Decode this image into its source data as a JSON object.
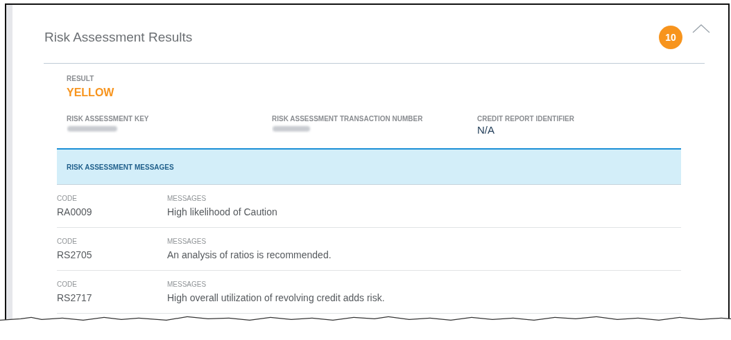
{
  "panel": {
    "title": "Risk Assessment Results",
    "badge": "10",
    "expanded": true
  },
  "result": {
    "label": "RESULT",
    "value": "YELLOW"
  },
  "fields": [
    {
      "label": "RISK ASSESSMENT KEY",
      "redacted": true
    },
    {
      "label": "RISK ASSESSMENT TRANSACTION NUMBER",
      "redacted": true
    },
    {
      "label": "CREDIT REPORT IDENTIFIER",
      "redacted": false,
      "value": "N/A"
    }
  ],
  "messages": {
    "heading": "RISK ASSESSMENT MESSAGES",
    "rows": [
      {
        "code_label": "CODE",
        "code": "RA0009",
        "message_label": "MESSAGES",
        "message": "High likelihood of Caution"
      },
      {
        "code_label": "CODE",
        "code": "RS2705",
        "message_label": "MESSAGES",
        "message": "An analysis of ratios is recommended."
      },
      {
        "code_label": "CODE",
        "code": "RS2717",
        "message_label": "MESSAGES",
        "message": "High overall utilization of revolving credit adds risk."
      }
    ]
  }
}
